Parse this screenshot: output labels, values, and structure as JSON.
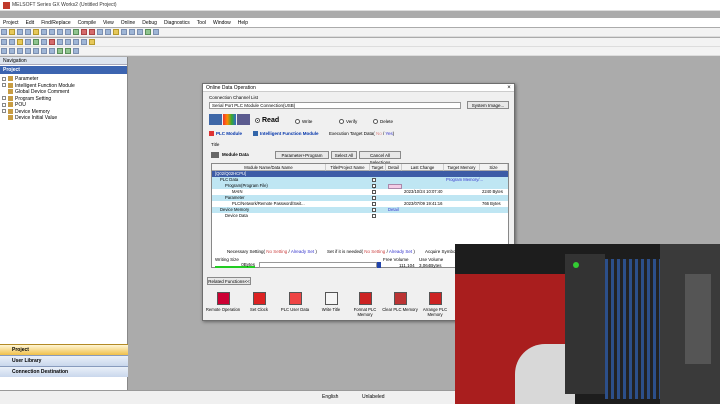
{
  "window": {
    "title": "MELSOFT Series GX Works2 (Untitled Project)"
  },
  "menu": [
    "Project",
    "Edit",
    "Find/Replace",
    "Compile",
    "View",
    "Online",
    "Debug",
    "Diagnostics",
    "Tool",
    "Window",
    "Help"
  ],
  "navigation": {
    "header": "Navigation",
    "section": "Project",
    "tree": [
      "Parameter",
      "Intelligent Function Module",
      "Global Device Comment",
      "Program Setting",
      "POU",
      "Device Memory",
      "Device Initial Value"
    ],
    "bottom_buttons": [
      "Project",
      "User Library",
      "Connection Destination"
    ]
  },
  "dialog": {
    "title": "Online Data Operation",
    "connection_channel_label": "Connection Channel List",
    "connection_value": "Serial Port  PLC Module Connection(USB)",
    "system_image_button": "System Image...",
    "modes": [
      {
        "label": "Read",
        "selected": true
      },
      {
        "label": "Write",
        "selected": false
      },
      {
        "label": "Verify",
        "selected": false
      },
      {
        "label": "Delete",
        "selected": false
      }
    ],
    "tabs": [
      "PLC Module",
      "Intelligent Function Module"
    ],
    "execution_target_label": "Execution Target Data(",
    "execution_target_no": "No",
    "execution_target_yes": "Yes",
    "title_label": "Title",
    "module_data_label": "Module Data",
    "buttons": [
      "Parameter+Program",
      "Select All",
      "Cancel All Selections"
    ],
    "columns": [
      "Module Name/Data Name",
      "Title/Project Name",
      "Target",
      "Detail",
      "Last Change",
      "Target Memory S...",
      "Size"
    ],
    "rows": [
      {
        "name": "[Q02/Q02HCPU]",
        "title": "",
        "target": false,
        "detail": "",
        "last_change": "",
        "memory": "",
        "size": "",
        "style": "dark",
        "indent": 0
      },
      {
        "name": "PLC Data",
        "title": "",
        "target": false,
        "detail": "",
        "last_change": "",
        "memory": "Program Memory/...",
        "size": "",
        "style": "blue",
        "indent": 1
      },
      {
        "name": "Program(Program File)",
        "title": "",
        "target": true,
        "detail": "Detail",
        "last_change": "",
        "memory": "",
        "size": "",
        "style": "blue",
        "indent": 2
      },
      {
        "name": "MAIN",
        "title": "",
        "target": true,
        "detail": "",
        "last_change": "2023/10/24 10:07:40",
        "memory": "",
        "size": "2240 Bytes",
        "style": "white",
        "indent": 3
      },
      {
        "name": "Parameter",
        "title": "",
        "target": true,
        "detail": "",
        "last_change": "",
        "memory": "",
        "size": "",
        "style": "blue",
        "indent": 2
      },
      {
        "name": "PLC/Network/Remote Password/Swit...",
        "title": "",
        "target": true,
        "detail": "",
        "last_change": "2023/07/09 19:41:16",
        "memory": "",
        "size": "766 Bytes",
        "style": "white",
        "indent": 3
      },
      {
        "name": "Device Memory",
        "title": "",
        "target": true,
        "detail": "Detail",
        "last_change": "",
        "memory": "",
        "size": "",
        "style": "blue",
        "indent": 1
      },
      {
        "name": "Device Data",
        "title": "",
        "target": true,
        "detail": "",
        "last_change": "",
        "memory": "",
        "size": "",
        "style": "white",
        "indent": 2
      }
    ],
    "necessary_setting": "Necessary Setting(",
    "no_setting": "No Setting",
    "already_set": "Already Set",
    "set_if_needed": "Set if it is needed(",
    "no_setting2": "No Setting",
    "already_set2": "Already Set",
    "acquire_symbolic": "Acquire Symboli...",
    "writing_size_label": "Writing Size",
    "writing_size_value": "0Bytes",
    "free_volume_label": "Free Volume",
    "free_volume_value": "111,104",
    "use_volume_label": "Use Volume",
    "use_volume_value": "3,064Bytes",
    "related_functions": "Related Functions<<",
    "functions": [
      "Remote Operation",
      "Set Clock",
      "PLC User Data",
      "Write Title",
      "Format PLC Memory",
      "Clear PLC Memory",
      "Arrange PLC Memory"
    ]
  },
  "status": {
    "language": "English",
    "state": "Unlabeled"
  },
  "colors": {
    "nav_selected": "#3c64b0",
    "row_blue": "#bfe6f3",
    "accent_orange": "#f0c04a"
  }
}
